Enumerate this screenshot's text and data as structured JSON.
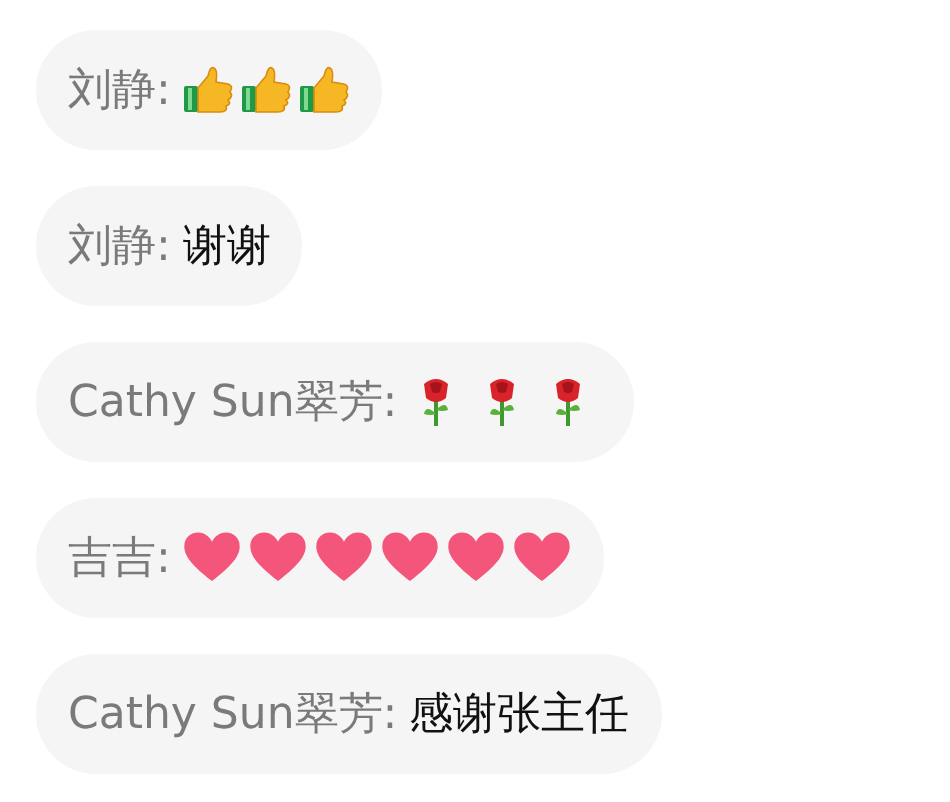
{
  "messages": [
    {
      "sender": "刘静:",
      "emojis": [
        {
          "kind": "thumbs-up"
        },
        {
          "kind": "thumbs-up"
        },
        {
          "kind": "thumbs-up"
        }
      ]
    },
    {
      "sender": "刘静:",
      "text": "谢谢"
    },
    {
      "sender": "Cathy Sun翠芳:",
      "emojis": [
        {
          "kind": "rose"
        },
        {
          "kind": "rose"
        },
        {
          "kind": "rose"
        }
      ]
    },
    {
      "sender": "吉吉:",
      "emojis": [
        {
          "kind": "heart"
        },
        {
          "kind": "heart"
        },
        {
          "kind": "heart"
        },
        {
          "kind": "heart"
        },
        {
          "kind": "heart"
        },
        {
          "kind": "heart"
        }
      ]
    },
    {
      "sender": "Cathy Sun翠芳:",
      "text": "感谢张主任"
    }
  ]
}
